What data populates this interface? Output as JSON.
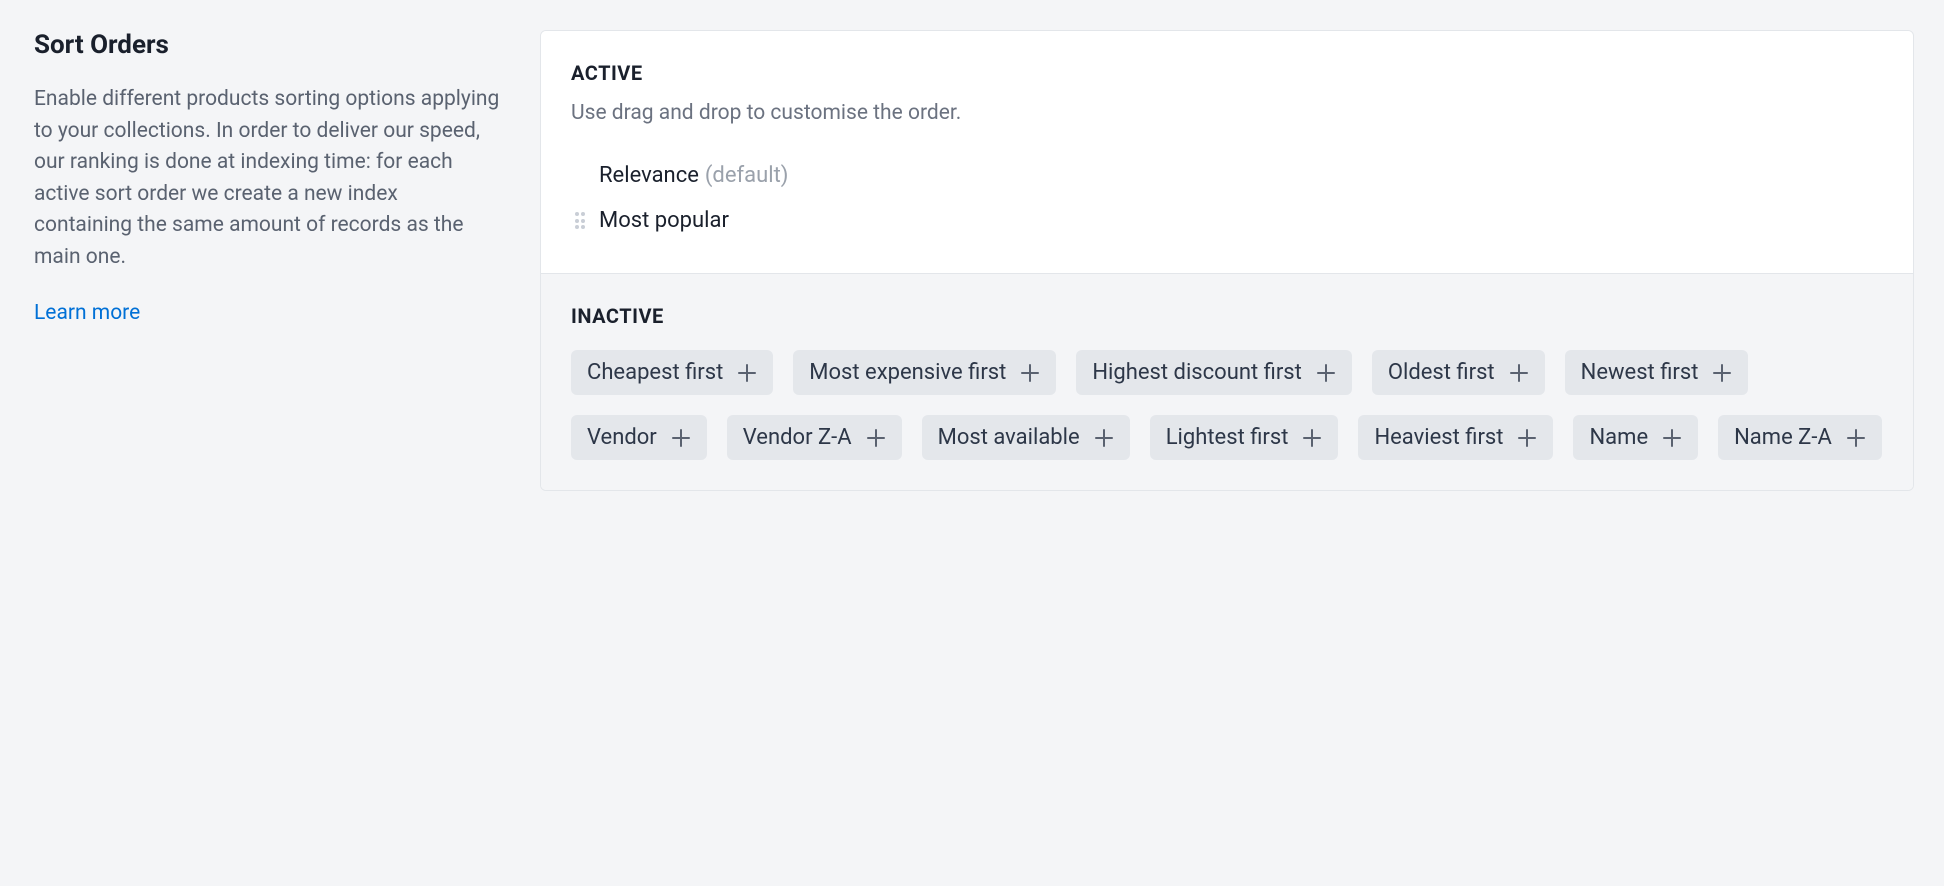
{
  "left": {
    "title": "Sort Orders",
    "description": "Enable different products sorting options applying to your collections. In order to deliver our speed, our ranking is done at indexing time: for each active sort order we create a new index containing the same amount of records as the main one.",
    "learn_more": "Learn more"
  },
  "active": {
    "heading": "ACTIVE",
    "subtext": "Use drag and drop to customise the order.",
    "items": [
      {
        "label": "Relevance",
        "default_tag": "(default)",
        "draggable": false
      },
      {
        "label": "Most popular",
        "default_tag": "",
        "draggable": true
      }
    ]
  },
  "inactive": {
    "heading": "INACTIVE",
    "chips": [
      "Cheapest first",
      "Most expensive first",
      "Highest discount first",
      "Oldest first",
      "Newest first",
      "Vendor",
      "Vendor Z-A",
      "Most available",
      "Lightest first",
      "Heaviest first",
      "Name",
      "Name Z-A"
    ]
  }
}
